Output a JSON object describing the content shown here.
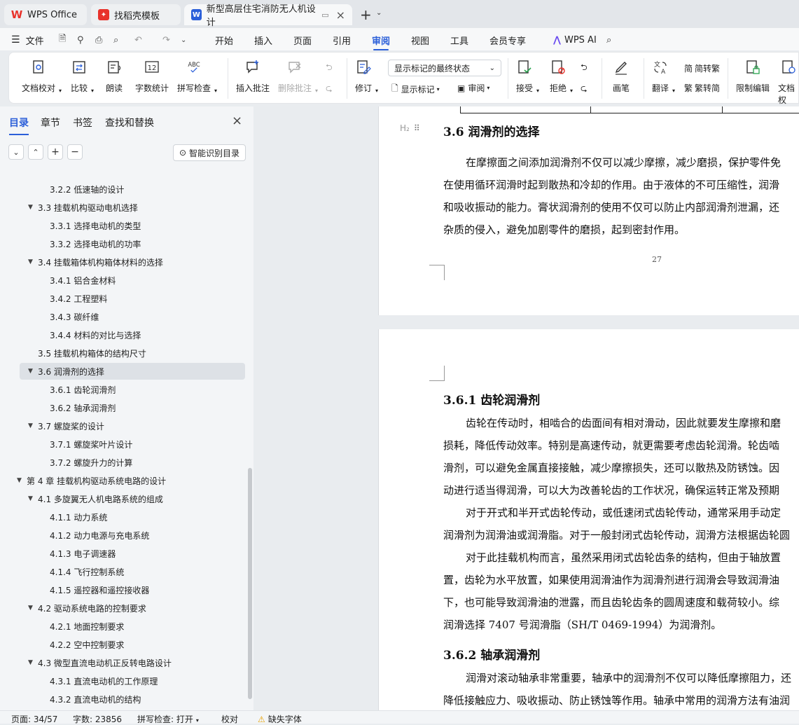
{
  "tabs": {
    "wps": "WPS Office",
    "template": "找稻壳模板",
    "document": "新型高层住宅消防无人机设计"
  },
  "menu": {
    "file": "文件",
    "items": [
      "开始",
      "插入",
      "页面",
      "引用",
      "审阅",
      "视图",
      "工具",
      "会员专享"
    ],
    "active": "审阅",
    "ai": "WPS AI"
  },
  "ribbon": {
    "proofread": "文档校对",
    "compare": "比较",
    "read_aloud": "朗读",
    "word_count": "字数统计",
    "spell_check": "拼写检查",
    "spell_icon_text": "ABC",
    "count_icon_text": "12",
    "insert_comment": "插入批注",
    "delete_comment": "删除批注",
    "revise": "修订",
    "markup_state": "显示标记的最终状态",
    "show_markup": "显示标记",
    "review": "审阅",
    "accept": "接受",
    "reject": "拒绝",
    "pen": "画笔",
    "translate": "翻译",
    "to_traditional": "简转繁",
    "to_simplified": "繁转简",
    "restrict_edit": "限制编辑",
    "doc_permission": "文档权"
  },
  "sidebar": {
    "tabs": [
      "目录",
      "章节",
      "书签",
      "查找和替换"
    ],
    "active_tab": "目录",
    "smart_button": "智能识别目录",
    "toc": [
      {
        "label": "3.2.2  低速轴的设计",
        "level": 3,
        "arrow": false
      },
      {
        "label": "3.3   挂载机构驱动电机选择",
        "level": 2,
        "arrow": true
      },
      {
        "label": "3.3.1   选择电动机的类型",
        "level": 3,
        "arrow": false
      },
      {
        "label": "3.3.2   选择电动机的功率",
        "level": 3,
        "arrow": false
      },
      {
        "label": "3.4 挂载箱体机构箱体材料的选择",
        "level": 2,
        "arrow": true
      },
      {
        "label": "3.4.1 铝合金材料",
        "level": 3,
        "arrow": false
      },
      {
        "label": "3.4.2 工程塑料",
        "level": 3,
        "arrow": false
      },
      {
        "label": "3.4.3 碳纤维",
        "level": 3,
        "arrow": false
      },
      {
        "label": "3.4.4 材料的对比与选择",
        "level": 3,
        "arrow": false
      },
      {
        "label": "3.5 挂载机构箱体的结构尺寸",
        "level": 2,
        "arrow": false
      },
      {
        "label": "3.6 润滑剂的选择",
        "level": 2,
        "arrow": true,
        "selected": true
      },
      {
        "label": "3.6.1 齿轮润滑剂",
        "level": 3,
        "arrow": false
      },
      {
        "label": "3.6.2 轴承润滑剂",
        "level": 3,
        "arrow": false
      },
      {
        "label": "3.7 螺旋桨的设计",
        "level": 2,
        "arrow": true
      },
      {
        "label": "3.7.1 螺旋桨叶片设计",
        "level": 3,
        "arrow": false
      },
      {
        "label": "3.7.2 螺旋升力的计算",
        "level": 3,
        "arrow": false
      },
      {
        "label": "第 4 章  挂载机构驱动系统电路的设计",
        "level": 1,
        "arrow": true
      },
      {
        "label": "4.1 多旋翼无人机电路系统的组成",
        "level": 2,
        "arrow": true
      },
      {
        "label": "4.1.1  动力系统",
        "level": 3,
        "arrow": false
      },
      {
        "label": "4.1.2  动力电源与充电系统",
        "level": 3,
        "arrow": false
      },
      {
        "label": "4.1.3  电子调速器",
        "level": 3,
        "arrow": false
      },
      {
        "label": "4.1.4  飞行控制系统",
        "level": 3,
        "arrow": false
      },
      {
        "label": "4.1.5  遥控器和遥控接收器",
        "level": 3,
        "arrow": false
      },
      {
        "label": "4.2 驱动系统电路的控制要求",
        "level": 2,
        "arrow": true
      },
      {
        "label": "4.2.1  地面控制要求",
        "level": 3,
        "arrow": false
      },
      {
        "label": "4.2.2  空中控制要求",
        "level": 3,
        "arrow": false
      },
      {
        "label": "4.3  微型直流电动机正反转电路设计",
        "level": 2,
        "arrow": true
      },
      {
        "label": "4.3.1  直流电动机的工作原理",
        "level": 3,
        "arrow": false
      },
      {
        "label": "4.3.2  直流电动机的结构",
        "level": 3,
        "arrow": false
      }
    ]
  },
  "doc": {
    "heading_marker": "H₂",
    "h36": "3.6  润滑剂的选择",
    "p1": [
      "在摩擦面之间添加润滑剂不仅可以减少摩擦，减少磨损，保护零件免",
      "在使用循环润滑时起到散热和冷却的作用。由于液体的不可压缩性，润滑",
      "和吸收振动的能力。膏状润滑剂的使用不仅可以防止内部润滑剂泄漏，还",
      "杂质的侵入，避免加剧零件的磨损，起到密封作用。"
    ],
    "page_number": "27",
    "h361": "3.6.1  齿轮润滑剂",
    "p2": [
      "齿轮在传动时，相啮合的齿面间有相对滑动，因此就要发生摩擦和磨",
      "损耗，降低传动效率。特别是高速传动，就更需要考虑齿轮润滑。轮齿啮",
      "滑剂，可以避免金属直接接触，减少摩擦损失，还可以散热及防锈蚀。因",
      "动进行适当得润滑，可以大为改善轮齿的工作状况，确保运转正常及预期",
      "对于开式和半开式齿轮传动，或低速闭式齿轮传动，通常采用手动定",
      "润滑剂为润滑油或润滑脂。对于一般封闭式齿轮传动，润滑方法根据齿轮圆",
      "对于此挂载机构而言，虽然采用闭式齿轮齿条的结构，但由于轴放置",
      "置，齿轮为水平放置，如果使用润滑油作为润滑剂进行润滑会导致润滑油",
      "下，也可能导致润滑油的泄露，而且齿轮齿条的圆周速度和载荷较小。综",
      "润滑选择 7407 号润滑脂（SH/T 0469-1994）为润滑剂。"
    ],
    "h362": "3.6.2  轴承润滑剂",
    "p3": [
      "润滑对滚动轴承非常重要，轴承中的润滑剂不仅可以降低摩擦阻力，还",
      "降低接触应力、吸收振动、防止锈蚀等作用。轴承中常用的润滑方法有油润"
    ]
  },
  "status": {
    "page": "页面: 34/57",
    "words": "字数: 23856",
    "spell": "拼写检查: 打开",
    "proof": "校对",
    "missing_font": "缺失字体"
  },
  "colors": {
    "accent": "#2b5fd9",
    "wps_red": "#e8322b"
  }
}
